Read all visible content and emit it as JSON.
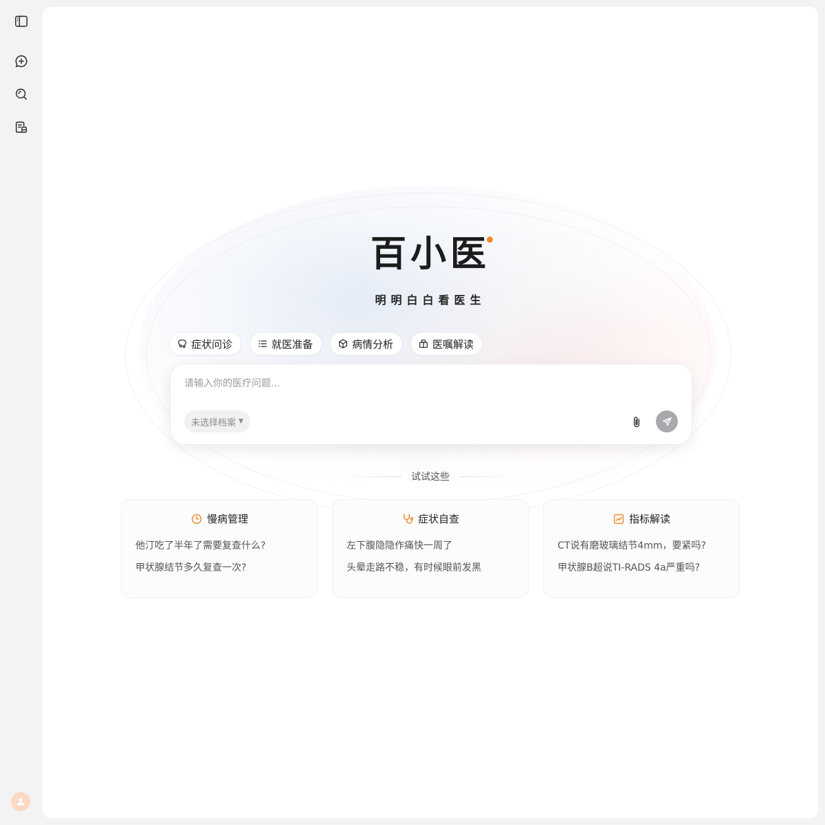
{
  "sidebar": {
    "items": [
      {
        "icon": "sidebar-toggle-icon"
      },
      {
        "icon": "new-chat-icon"
      },
      {
        "icon": "search-icon"
      },
      {
        "icon": "records-icon"
      }
    ],
    "avatar_icon": "user-icon"
  },
  "brand": {
    "logo": "百小医",
    "slogan": "明明白白看医生",
    "accent_color": "#f08a2c"
  },
  "modes": [
    {
      "label": "症状问诊",
      "icon": "symptom-icon"
    },
    {
      "label": "就医准备",
      "icon": "list-icon"
    },
    {
      "label": "病情分析",
      "icon": "analysis-icon"
    },
    {
      "label": "医嘱解读",
      "icon": "prescription-icon"
    }
  ],
  "input": {
    "placeholder": "请输入你的医疗问题...",
    "profile_select": "未选择档案",
    "attach_icon": "paperclip-icon",
    "send_icon": "send-icon"
  },
  "suggestions": {
    "heading": "试试这些",
    "cards": [
      {
        "title": "慢病管理",
        "icon": "clock-icon",
        "questions": [
          "他汀吃了半年了需要复查什么?",
          "甲状腺结节多久复查一次?"
        ]
      },
      {
        "title": "症状自查",
        "icon": "stethoscope-icon",
        "questions": [
          "左下腹隐隐作痛快一周了",
          "头晕走路不稳，有时候眼前发黑"
        ]
      },
      {
        "title": "指标解读",
        "icon": "trend-chart-icon",
        "questions": [
          "CT说有磨玻璃结节4mm，要紧吗?",
          "甲状腺B超说TI-RADS 4a严重吗?"
        ]
      }
    ]
  }
}
